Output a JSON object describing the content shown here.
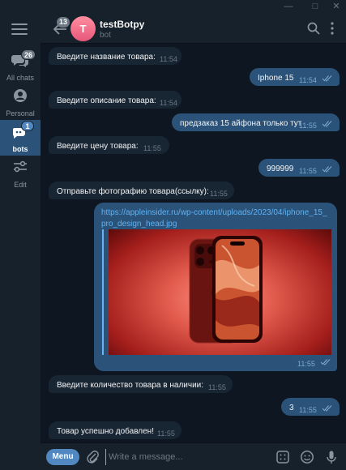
{
  "window": {
    "minimize_icon": "minimize-icon",
    "maximize_icon": "maximize-icon",
    "close_icon": "close-icon"
  },
  "sidebar": {
    "menu_icon": "hamburger-icon",
    "folders": [
      {
        "label": "All chats",
        "badge": "26",
        "icon": "chat-bubbles-icon"
      },
      {
        "label": "Personal",
        "badge": "",
        "icon": "person-icon"
      },
      {
        "label": "bots",
        "badge": "1",
        "icon": "robot-icon",
        "active": true
      },
      {
        "label": "Edit",
        "badge": "",
        "icon": "sliders-icon"
      }
    ]
  },
  "header": {
    "back_badge": "13",
    "avatar_letter": "T",
    "title": "testBotpy",
    "subtitle": "bot",
    "search_icon": "search-icon",
    "more_icon": "more-vertical-icon"
  },
  "messages": [
    {
      "dir": "in",
      "text": "Введите название товара:",
      "time": "11:54"
    },
    {
      "dir": "out",
      "text": "Iphone 15",
      "time": "11:54"
    },
    {
      "dir": "in",
      "text": "Введите описание товара:",
      "time": "11:54"
    },
    {
      "dir": "out",
      "text": "предзаказ 15 айфона только тут",
      "time": "11:55"
    },
    {
      "dir": "in",
      "text": "Введите цену товара:",
      "time": "11:55"
    },
    {
      "dir": "out",
      "text": "999999",
      "time": "11:55"
    },
    {
      "dir": "in",
      "text": "Отправьте фотографию товара(ссылку):",
      "time": "11:55"
    },
    {
      "dir": "out",
      "link": "https://appleinsider.ru/wp-content/uploads/2023/04/iphone_15_pro_design_head.jpg",
      "time": "11:55",
      "has_preview_image": true
    },
    {
      "dir": "in",
      "text": "Введите количество товара в наличии:",
      "time": "11:55"
    },
    {
      "dir": "out",
      "text": "3",
      "time": "11:55"
    },
    {
      "dir": "in",
      "text": "Товар успешно добавлен!",
      "time": "11:55"
    }
  ],
  "composer": {
    "menu_label": "Menu",
    "placeholder": "Write a message...",
    "attach_icon": "paperclip-icon",
    "bot_commands_icon": "bot-commands-icon",
    "emoji_icon": "emoji-icon",
    "mic_icon": "microphone-icon"
  },
  "colors": {
    "background": "#0e1621",
    "panel": "#17212b",
    "incoming_bubble": "#182533",
    "outgoing_bubble": "#2b5278",
    "accent": "#5288c1",
    "link": "#5fb3f5"
  }
}
